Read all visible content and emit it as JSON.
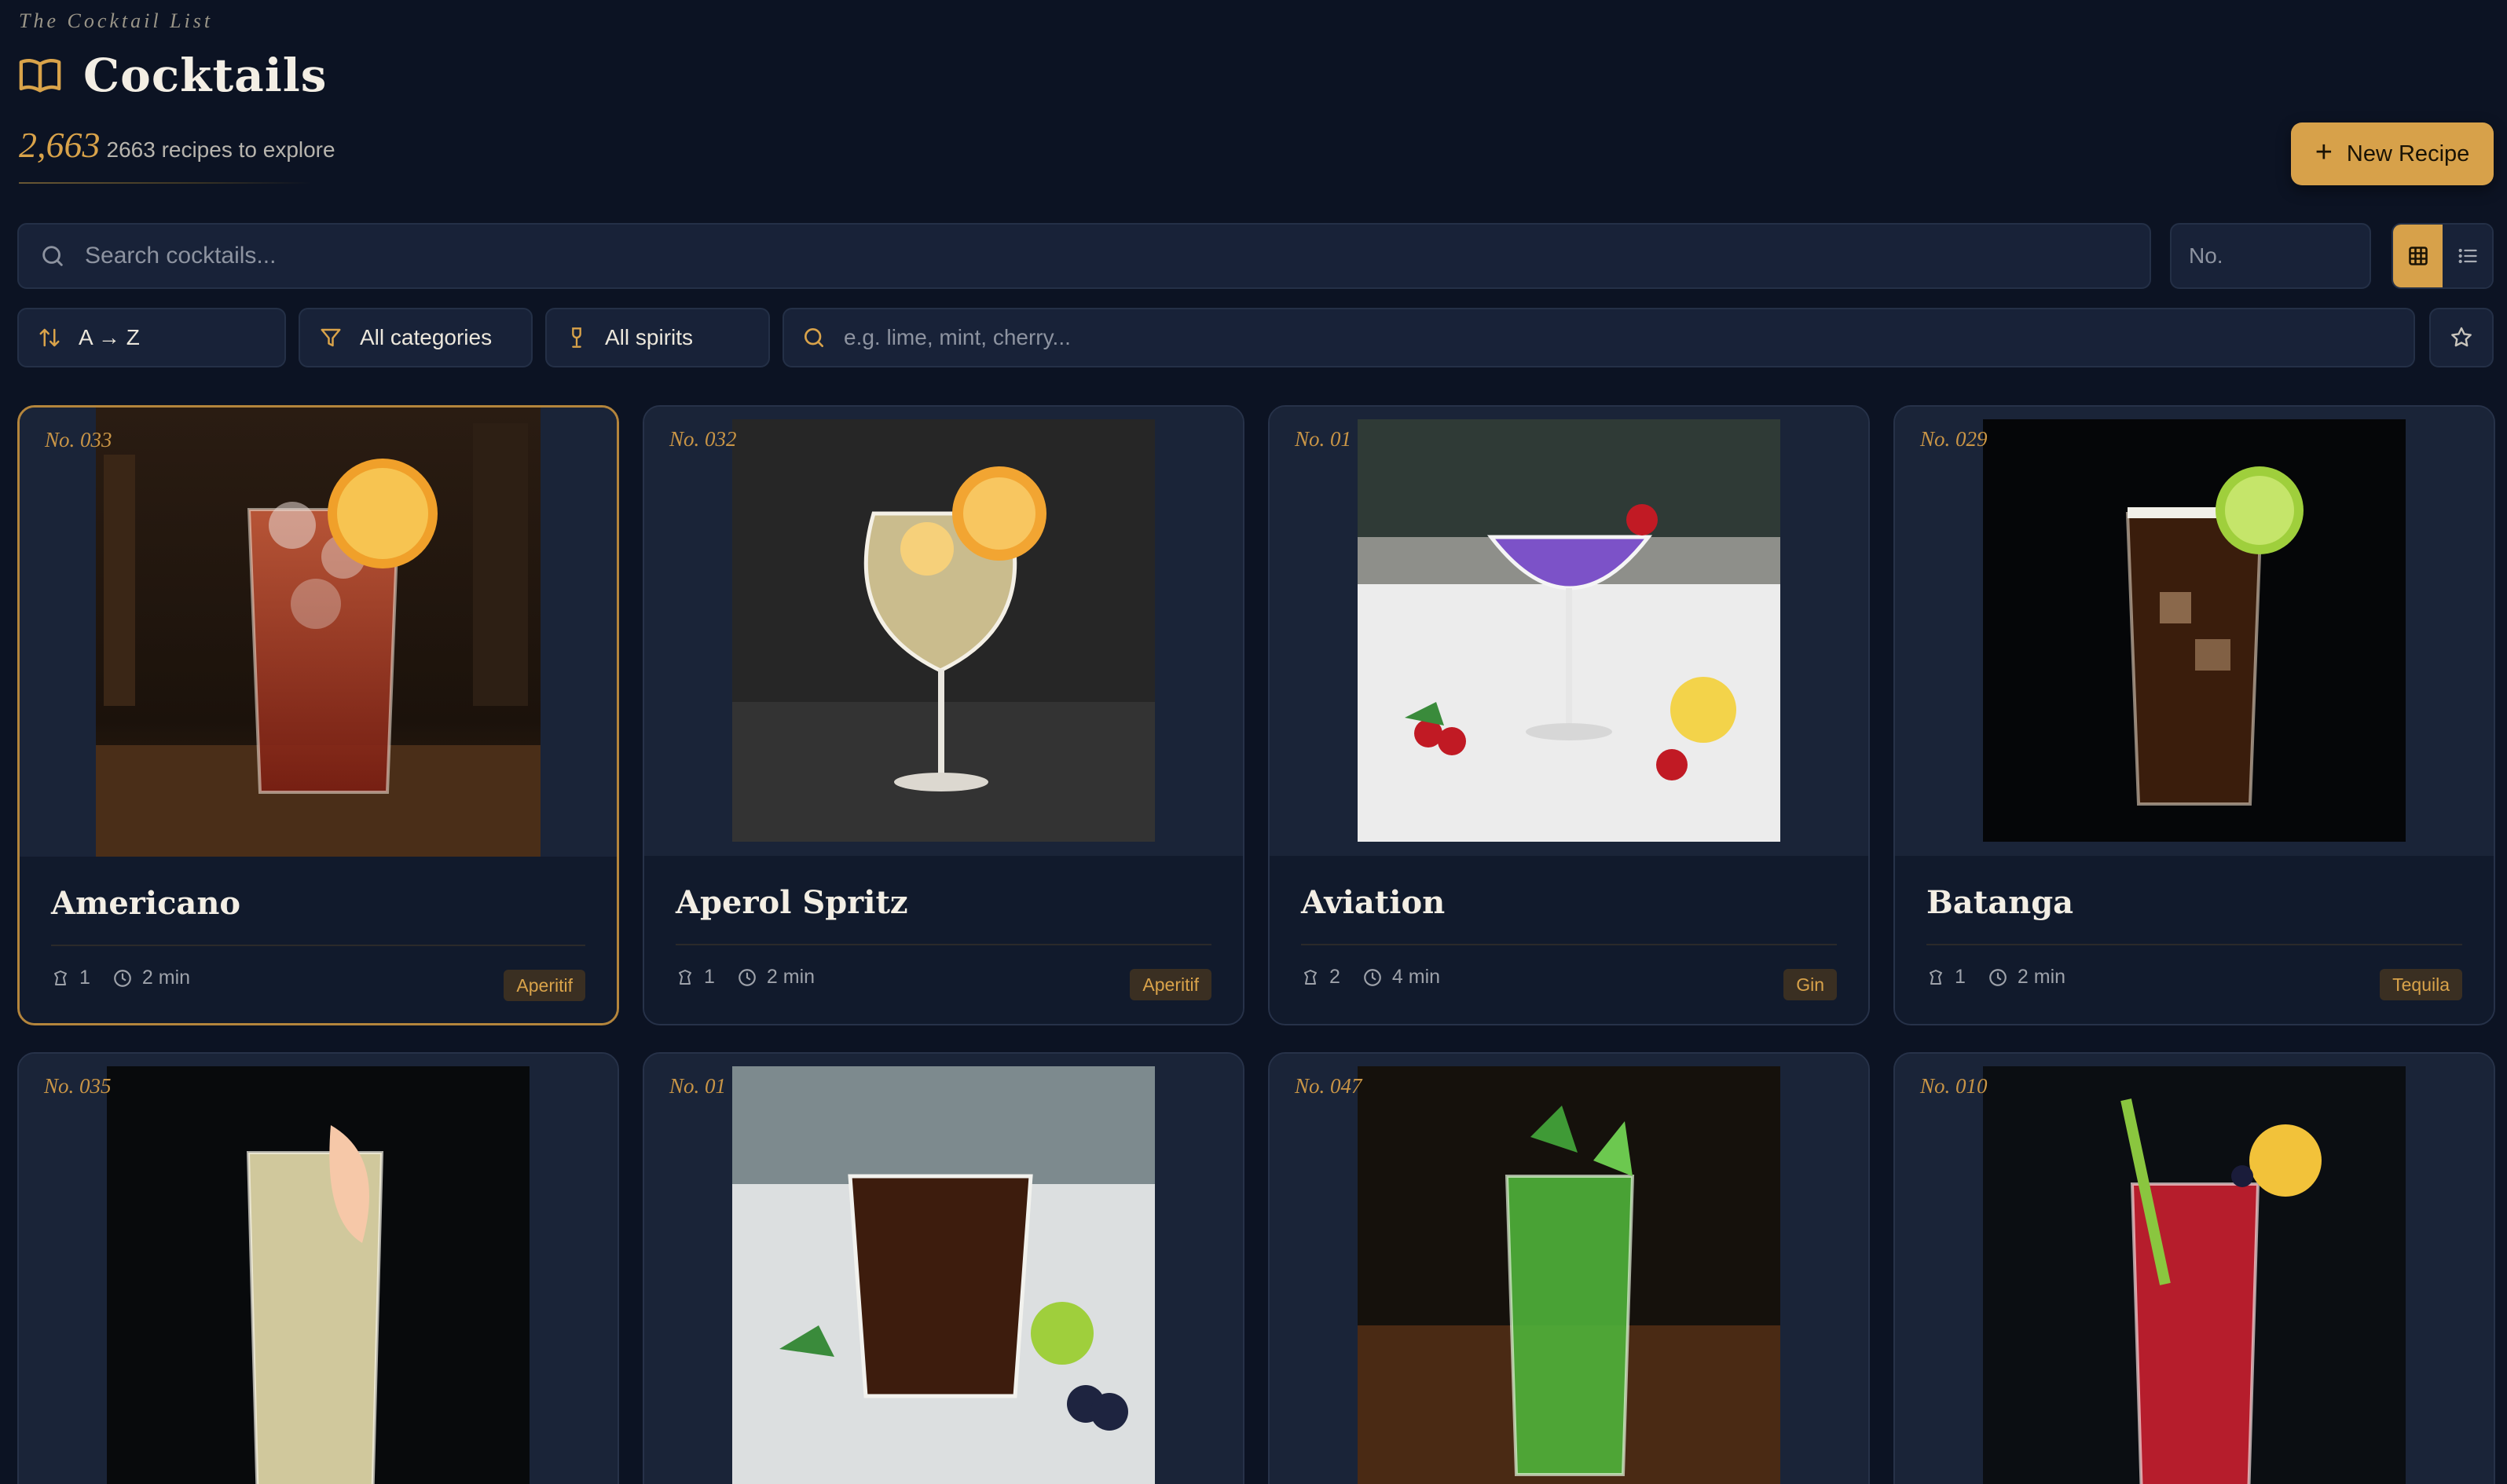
{
  "header": {
    "eyebrow": "The Cocktail List",
    "title": "Cocktails",
    "count_big": "2,663",
    "count_sub": "2663 recipes to explore",
    "new_recipe_label": "New Recipe"
  },
  "search": {
    "placeholder": "Search cocktails...",
    "number_placeholder": "No."
  },
  "filters": {
    "sort_label": "A → Z",
    "category_label": "All categories",
    "spirit_label": "All spirits",
    "ingredient_placeholder": "e.g. lime, mint, cherry..."
  },
  "view_toggle": {
    "active": "grid"
  },
  "colors": {
    "background": "#0c1323",
    "accent": "#d7a14a",
    "card": "#172136",
    "tag_bg": "#3a2f22"
  },
  "cards": [
    {
      "number": "No. 033",
      "name": "Americano",
      "glasses": "1",
      "time": "2 min",
      "tag": "Aperitif",
      "selected": true
    },
    {
      "number": "No. 032",
      "name": "Aperol Spritz",
      "glasses": "1",
      "time": "2 min",
      "tag": "Aperitif"
    },
    {
      "number": "No. 01",
      "name": "Aviation",
      "glasses": "2",
      "time": "4 min",
      "tag": "Gin"
    },
    {
      "number": "No. 029",
      "name": "Batanga",
      "glasses": "1",
      "time": "2 min",
      "tag": "Tequila"
    },
    {
      "number": "No. 035"
    },
    {
      "number": "No. 01"
    },
    {
      "number": "No. 047"
    },
    {
      "number": "No. 010"
    }
  ]
}
